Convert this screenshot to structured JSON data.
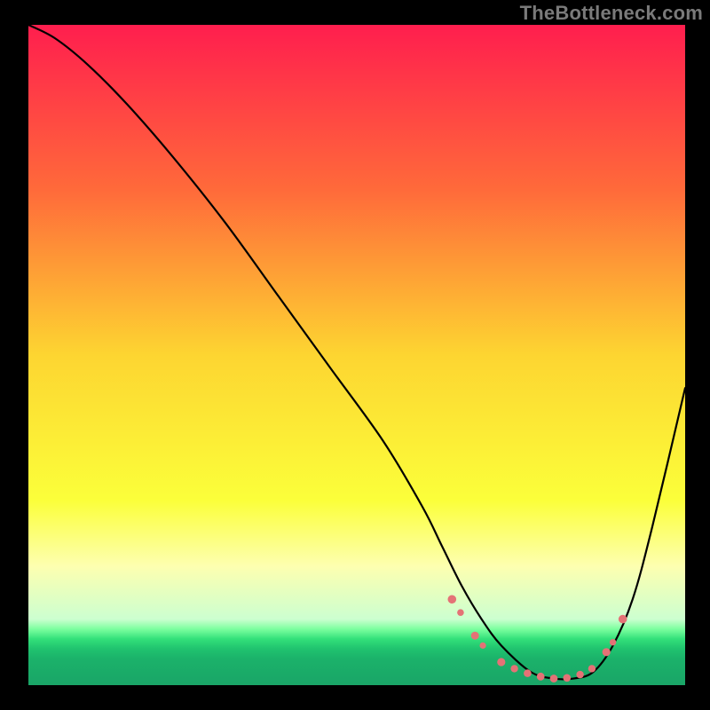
{
  "watermark": "TheBottleneck.com",
  "chart_data": {
    "type": "line",
    "title": "",
    "xlabel": "",
    "ylabel": "",
    "xlim": [
      0,
      100
    ],
    "ylim": [
      0,
      100
    ],
    "background_gradient": {
      "stops": [
        {
          "t": 0.0,
          "color": "#ff1e4e"
        },
        {
          "t": 0.25,
          "color": "#ff6a3a"
        },
        {
          "t": 0.5,
          "color": "#fdd531"
        },
        {
          "t": 0.72,
          "color": "#fbff3a"
        },
        {
          "t": 0.82,
          "color": "#fdffb0"
        },
        {
          "t": 0.9,
          "color": "#ccffd0"
        },
        {
          "t": 0.915,
          "color": "#7cff9f"
        },
        {
          "t": 0.93,
          "color": "#33e07a"
        },
        {
          "t": 0.945,
          "color": "#20c36f"
        },
        {
          "t": 0.96,
          "color": "#1bb26a"
        },
        {
          "t": 1.0,
          "color": "#1aa567"
        }
      ]
    },
    "series": [
      {
        "name": "curve",
        "stroke": "#000000",
        "strokeWidth": 2.2,
        "x": [
          0,
          4,
          9,
          15,
          22,
          30,
          38,
          46,
          54,
          60,
          63,
          66,
          69,
          72,
          76.5,
          80,
          83,
          86,
          89,
          92,
          95,
          100
        ],
        "y": [
          100,
          98,
          94,
          88,
          80,
          70,
          59,
          48,
          37,
          27,
          21,
          15,
          10,
          6,
          2,
          1,
          1,
          2,
          6,
          13,
          24,
          45
        ]
      }
    ],
    "markers": {
      "color": "#e47276",
      "points": [
        {
          "x": 64.5,
          "y": 13,
          "r": 4.8
        },
        {
          "x": 65.8,
          "y": 11,
          "r": 3.8
        },
        {
          "x": 68.0,
          "y": 7.5,
          "r": 4.5
        },
        {
          "x": 69.2,
          "y": 6.0,
          "r": 3.6
        },
        {
          "x": 72.0,
          "y": 3.5,
          "r": 4.6
        },
        {
          "x": 74.0,
          "y": 2.5,
          "r": 4.2
        },
        {
          "x": 76.0,
          "y": 1.8,
          "r": 4.3
        },
        {
          "x": 78.0,
          "y": 1.3,
          "r": 4.4
        },
        {
          "x": 80.0,
          "y": 1.0,
          "r": 4.4
        },
        {
          "x": 82.0,
          "y": 1.1,
          "r": 4.3
        },
        {
          "x": 84.0,
          "y": 1.6,
          "r": 4.2
        },
        {
          "x": 85.8,
          "y": 2.5,
          "r": 4.2
        },
        {
          "x": 88.0,
          "y": 5.0,
          "r": 4.6
        },
        {
          "x": 89.0,
          "y": 6.5,
          "r": 3.7
        },
        {
          "x": 90.5,
          "y": 10.0,
          "r": 4.8
        }
      ]
    }
  }
}
